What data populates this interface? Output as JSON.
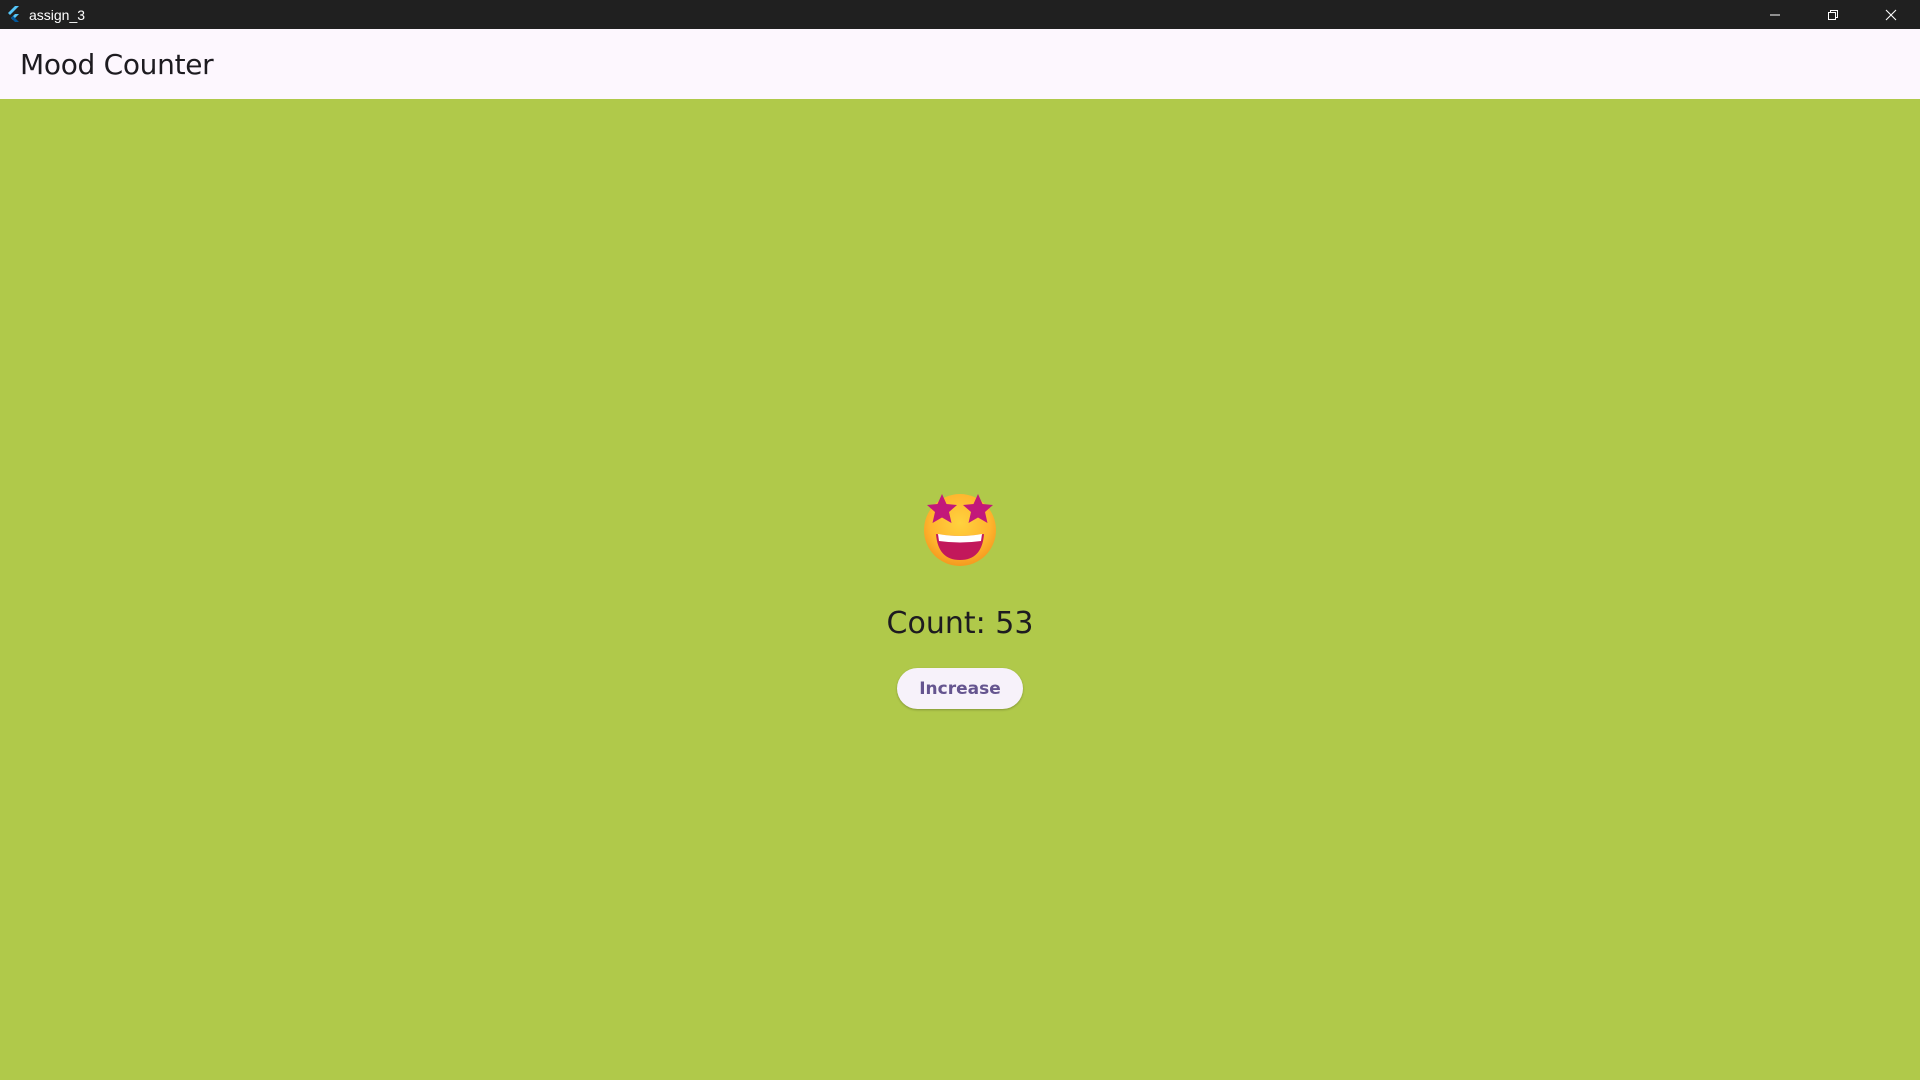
{
  "window": {
    "title": "assign_3",
    "controls": [
      "minimize",
      "restore",
      "close"
    ]
  },
  "appbar": {
    "title": "Mood Counter"
  },
  "main": {
    "emoji_icon": "star-struck-emoji-icon",
    "count_label": "Count: 53",
    "increase_label": "Increase"
  },
  "colors": {
    "background": "#b0c94a",
    "appbar": "#fdf7fe",
    "titlebar": "#202020",
    "button_text": "#65558f"
  }
}
